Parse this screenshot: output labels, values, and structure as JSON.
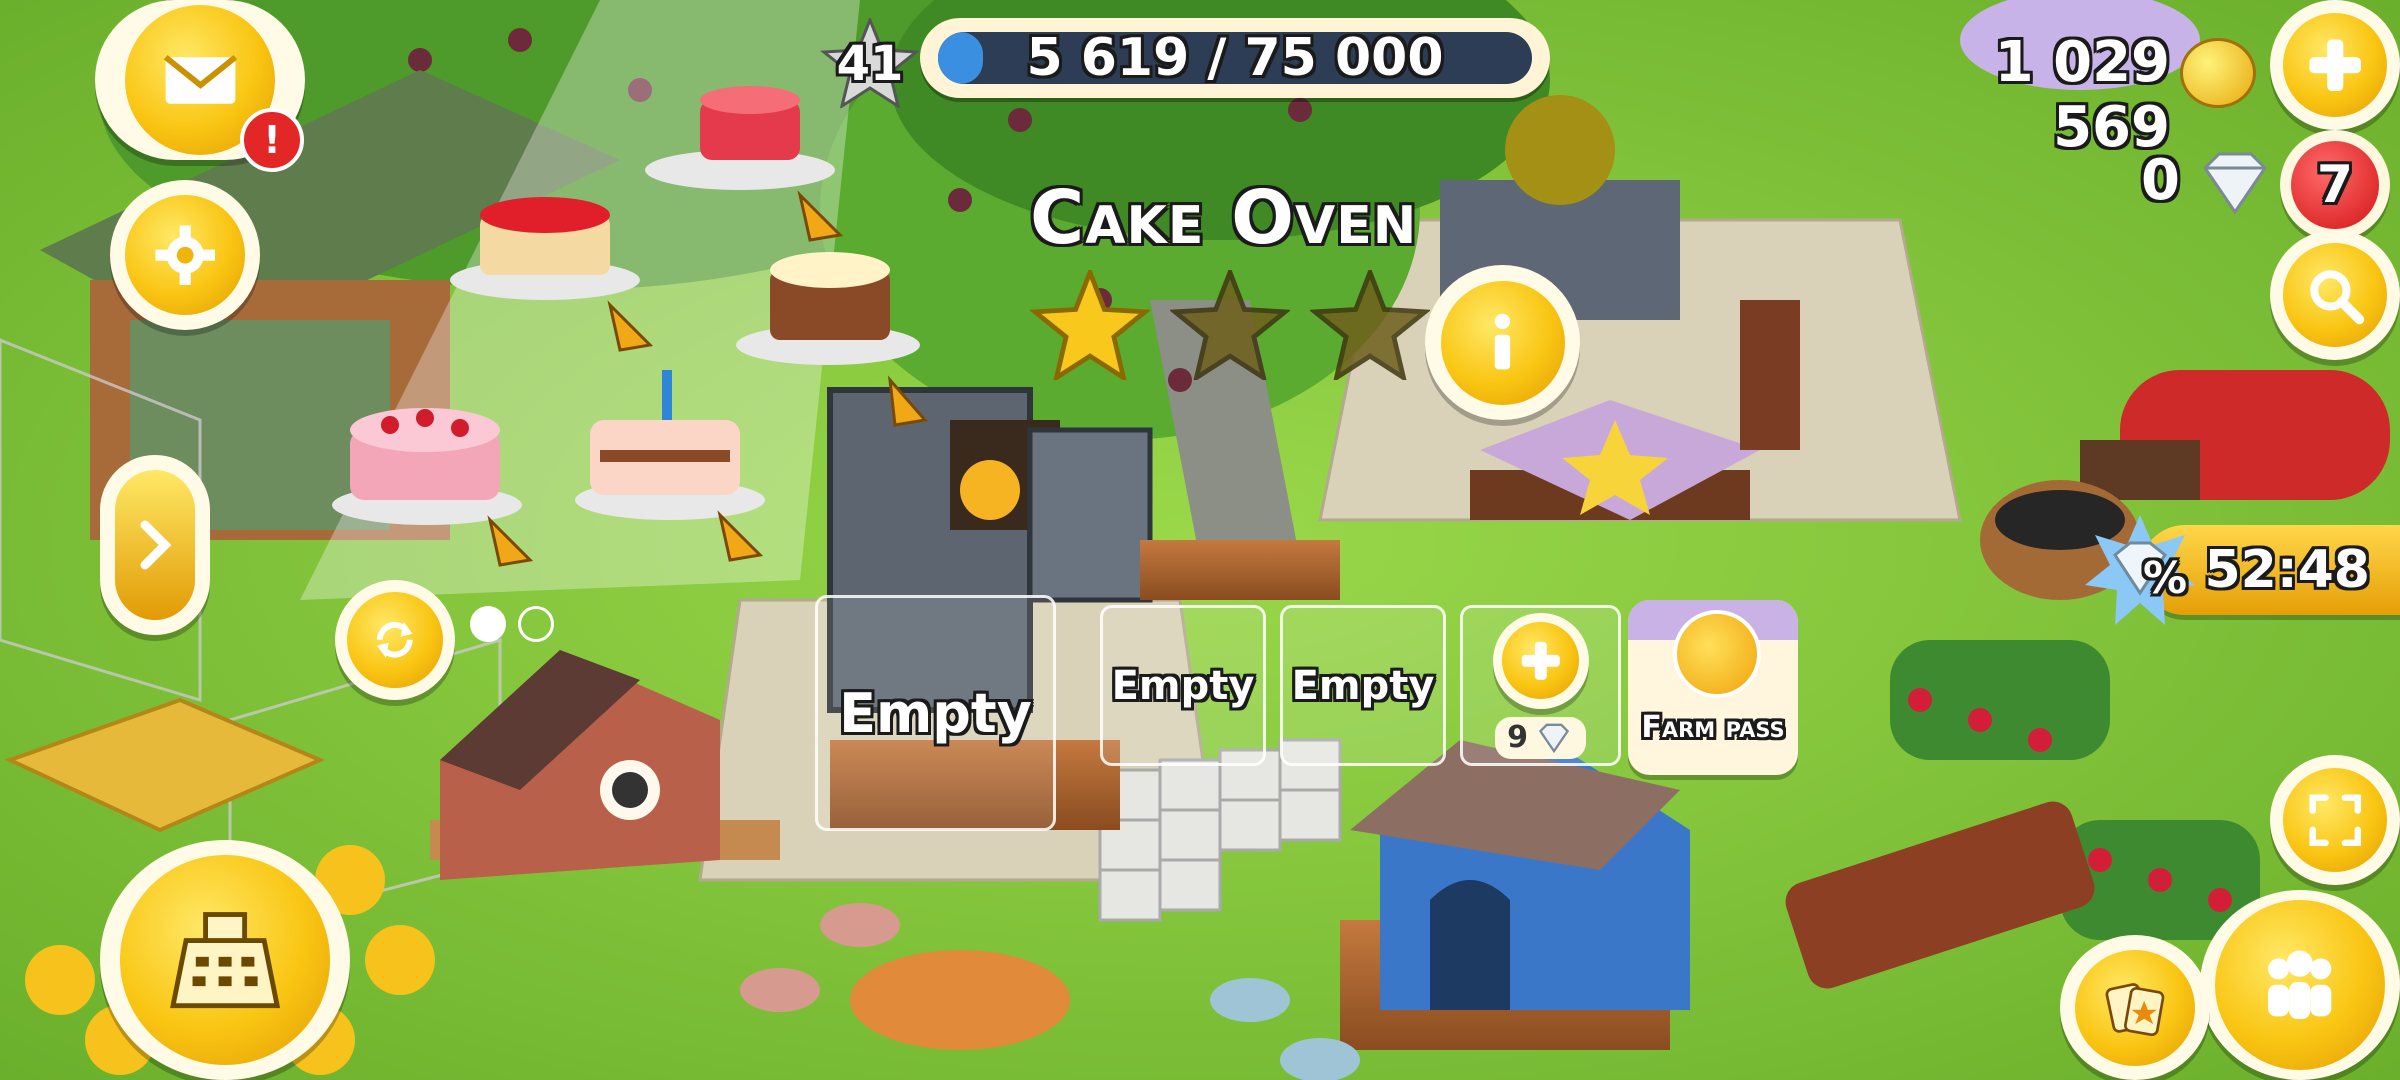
{
  "hud": {
    "level": "41",
    "xp_text": "5 619 / 75 000",
    "xp_progress": 0.075,
    "coins": "1 029 569",
    "diamonds": "0",
    "notification_count": "7"
  },
  "building": {
    "title": "Cake Oven",
    "stars_earned": 1,
    "stars_total": 3
  },
  "queue": {
    "slots": [
      "Empty",
      "Empty",
      "Empty"
    ],
    "add_slot_cost": "9",
    "farm_pass_label": "Farm pass"
  },
  "offer": {
    "timer": "52:48",
    "badge_symbol": "%"
  },
  "recipes": {
    "page_count": 2,
    "active_page": 0
  },
  "colors": {
    "grass": "#7fc43a",
    "button_yellow": "#f9c512",
    "xp_bar_fill": "#3b8fe0",
    "badge_red": "#e32626"
  }
}
